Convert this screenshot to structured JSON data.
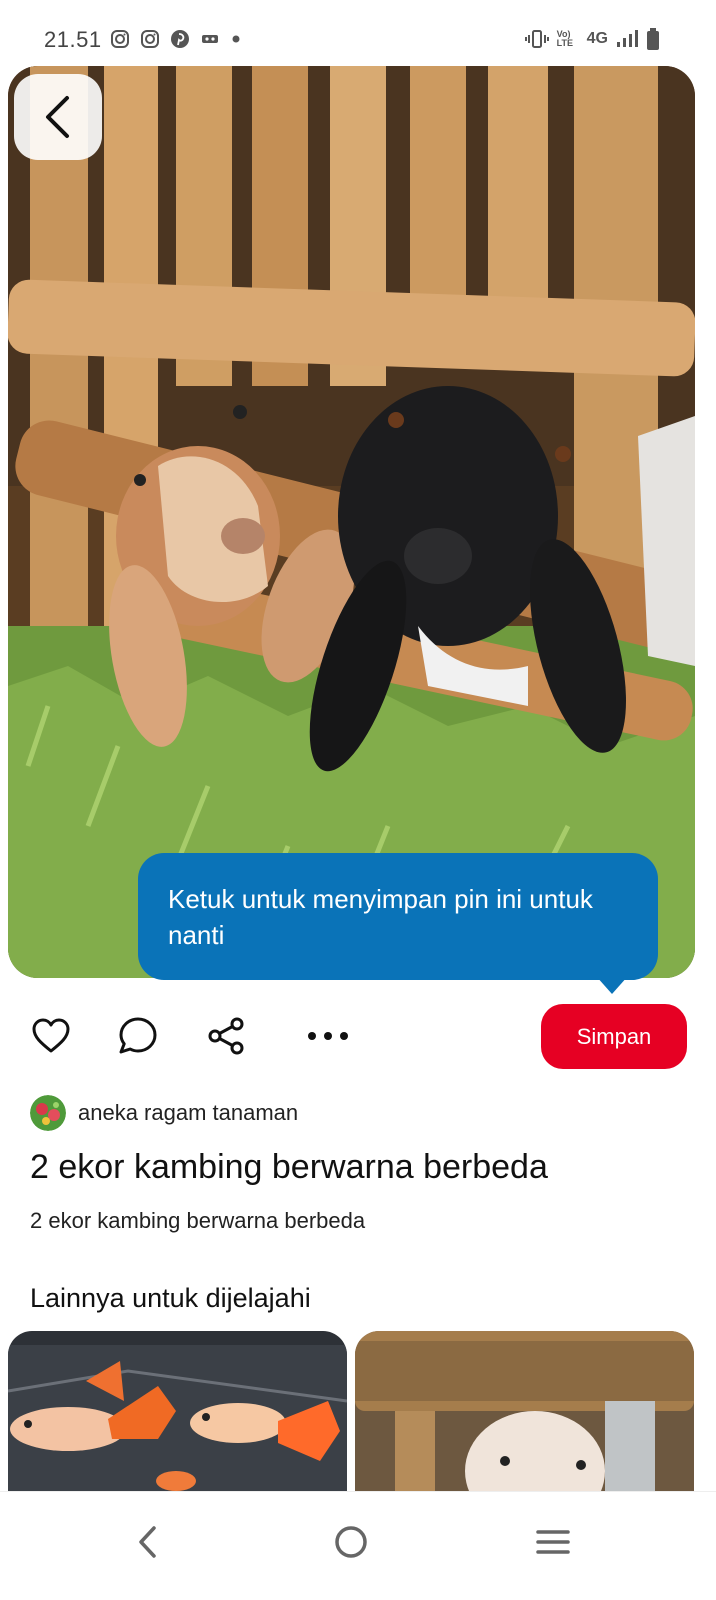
{
  "status_bar": {
    "time": "21.51",
    "app_icons": [
      "instagram-icon",
      "instagram-icon",
      "pinterest-icon",
      "vr-icon",
      "dot-icon"
    ],
    "lte_label": "Vo) LTE",
    "network": "4G",
    "icons": [
      "vibrate-icon",
      "signal-icon",
      "battery-icon"
    ]
  },
  "pin": {
    "image_subject": "two goats",
    "tooltip": "Ketuk untuk menyimpan pin ini untuk nanti",
    "save_label": "Simpan",
    "author": "aneka ragam tanaman",
    "title": "2 ekor kambing berwarna berbeda",
    "description": "2 ekor kambing berwarna berbeda"
  },
  "actions": [
    "heart-icon",
    "comment-icon",
    "share-icon",
    "more-icon"
  ],
  "related": {
    "title": "Lainnya untuk dijelajahi",
    "cards": [
      {
        "subject": "guppy fish"
      },
      {
        "subject": "goat"
      }
    ]
  },
  "nav": [
    "back-nav-icon",
    "home-nav-icon",
    "recents-nav-icon"
  ],
  "colors": {
    "save_button": "#e60023",
    "tooltip": "#0a73b8"
  }
}
